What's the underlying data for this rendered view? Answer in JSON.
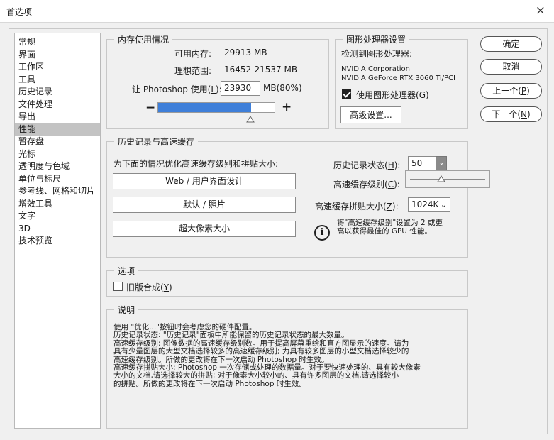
{
  "window": {
    "title": "首选项",
    "close_label": "×"
  },
  "sidebar": {
    "items": [
      {
        "label": "常规"
      },
      {
        "label": "界面"
      },
      {
        "label": "工作区"
      },
      {
        "label": "工具"
      },
      {
        "label": "历史记录"
      },
      {
        "label": "文件处理"
      },
      {
        "label": "导出"
      },
      {
        "label": "性能"
      },
      {
        "label": "暂存盘"
      },
      {
        "label": "光标"
      },
      {
        "label": "透明度与色域"
      },
      {
        "label": "单位与标尺"
      },
      {
        "label": "参考线、网格和切片"
      },
      {
        "label": "增效工具"
      },
      {
        "label": "文字"
      },
      {
        "label": "3D"
      },
      {
        "label": "技术预览"
      }
    ],
    "selected": "性能"
  },
  "memory": {
    "legend": "内存使用情况",
    "available_label": "可用内存:",
    "available_value": "29913 MB",
    "ideal_label": "理想范围:",
    "ideal_value": "16452-21537 MB",
    "let_label_pre": "让 Photoshop 使用(",
    "let_label_key": "L",
    "let_label_post": "):",
    "input_value": "23930",
    "unit_percent": "MB(80%)",
    "minus": "−",
    "plus": "+",
    "usage_fraction": 0.8
  },
  "gpu": {
    "legend": "图形处理器设置",
    "detected_label": "检测到图形处理器:",
    "vendor": "NVIDIA Corporation",
    "model": "NVIDIA GeForce RTX 3060 Ti/PCI",
    "use_gpu_pre": "使用图形处理器(",
    "use_gpu_key": "G",
    "use_gpu_post": ")",
    "use_gpu_checked": true,
    "advanced_button": "高级设置..."
  },
  "history_cache": {
    "legend": "历史记录与高速缓存",
    "optimize_label": "为下面的情况优化高速缓存级别和拼贴大小:",
    "btn_web": "Web / 用户界面设计",
    "btn_default": "默认 / 照片",
    "btn_huge": "超大像素大小",
    "history_states_pre": "历史记录状态(",
    "history_states_key": "H",
    "history_states_post": "):",
    "history_states_value": "50",
    "cache_levels_pre": "高速缓存级别(",
    "cache_levels_key": "C",
    "cache_levels_post": "):",
    "cache_tile_pre": "高速缓存拼贴大小(",
    "cache_tile_key": "Z",
    "cache_tile_post": "):",
    "cache_tile_value": "1024K",
    "info_line1": "将\"高速缓存级别\"设置为 2 或更",
    "info_line2": "高以获得最佳的 GPU 性能。"
  },
  "options": {
    "legend": "选项",
    "legacy_pre": "旧版合成(",
    "legacy_key": "Y",
    "legacy_post": ")",
    "legacy_checked": false
  },
  "description": {
    "legend": "说明",
    "lines": [
      "使用 \"优化...\"按钮时会考虑您的硬件配置。",
      "历史记录状态: \"历史记录\"面板中所能保留的历史记录状态的最大数量。",
      "高速缓存级别: 图像数据的高速缓存级别数。用于提高屏幕重绘和直方图显示的速度。请为",
      "具有少量图层的大型文档选择较多的高速缓存级别; 为具有较多图层的小型文档选择较少的",
      "高速缓存级别。所做的更改将在下一次启动 Photoshop 时生效。",
      "高速缓存拼贴大小: Photoshop 一次存储或处理的数据量。对于要快速处理的、具有较大像素",
      "大小的文档,请选择较大的拼贴; 对于像素大小较小的、具有许多图层的文档,请选择较小",
      "的拼贴。所做的更改将在下一次启动 Photoshop 时生效。"
    ]
  },
  "buttons": {
    "ok": "确定",
    "cancel": "取消",
    "prev_pre": "上一个(",
    "prev_key": "P",
    "prev_post": ")",
    "next_pre": "下一个(",
    "next_key": "N",
    "next_post": ")"
  },
  "icons": {
    "info": "i",
    "dropdown": "⌄"
  },
  "colors": {
    "accent": "#3e7fd9",
    "selected_bg": "#c3c3c3"
  }
}
